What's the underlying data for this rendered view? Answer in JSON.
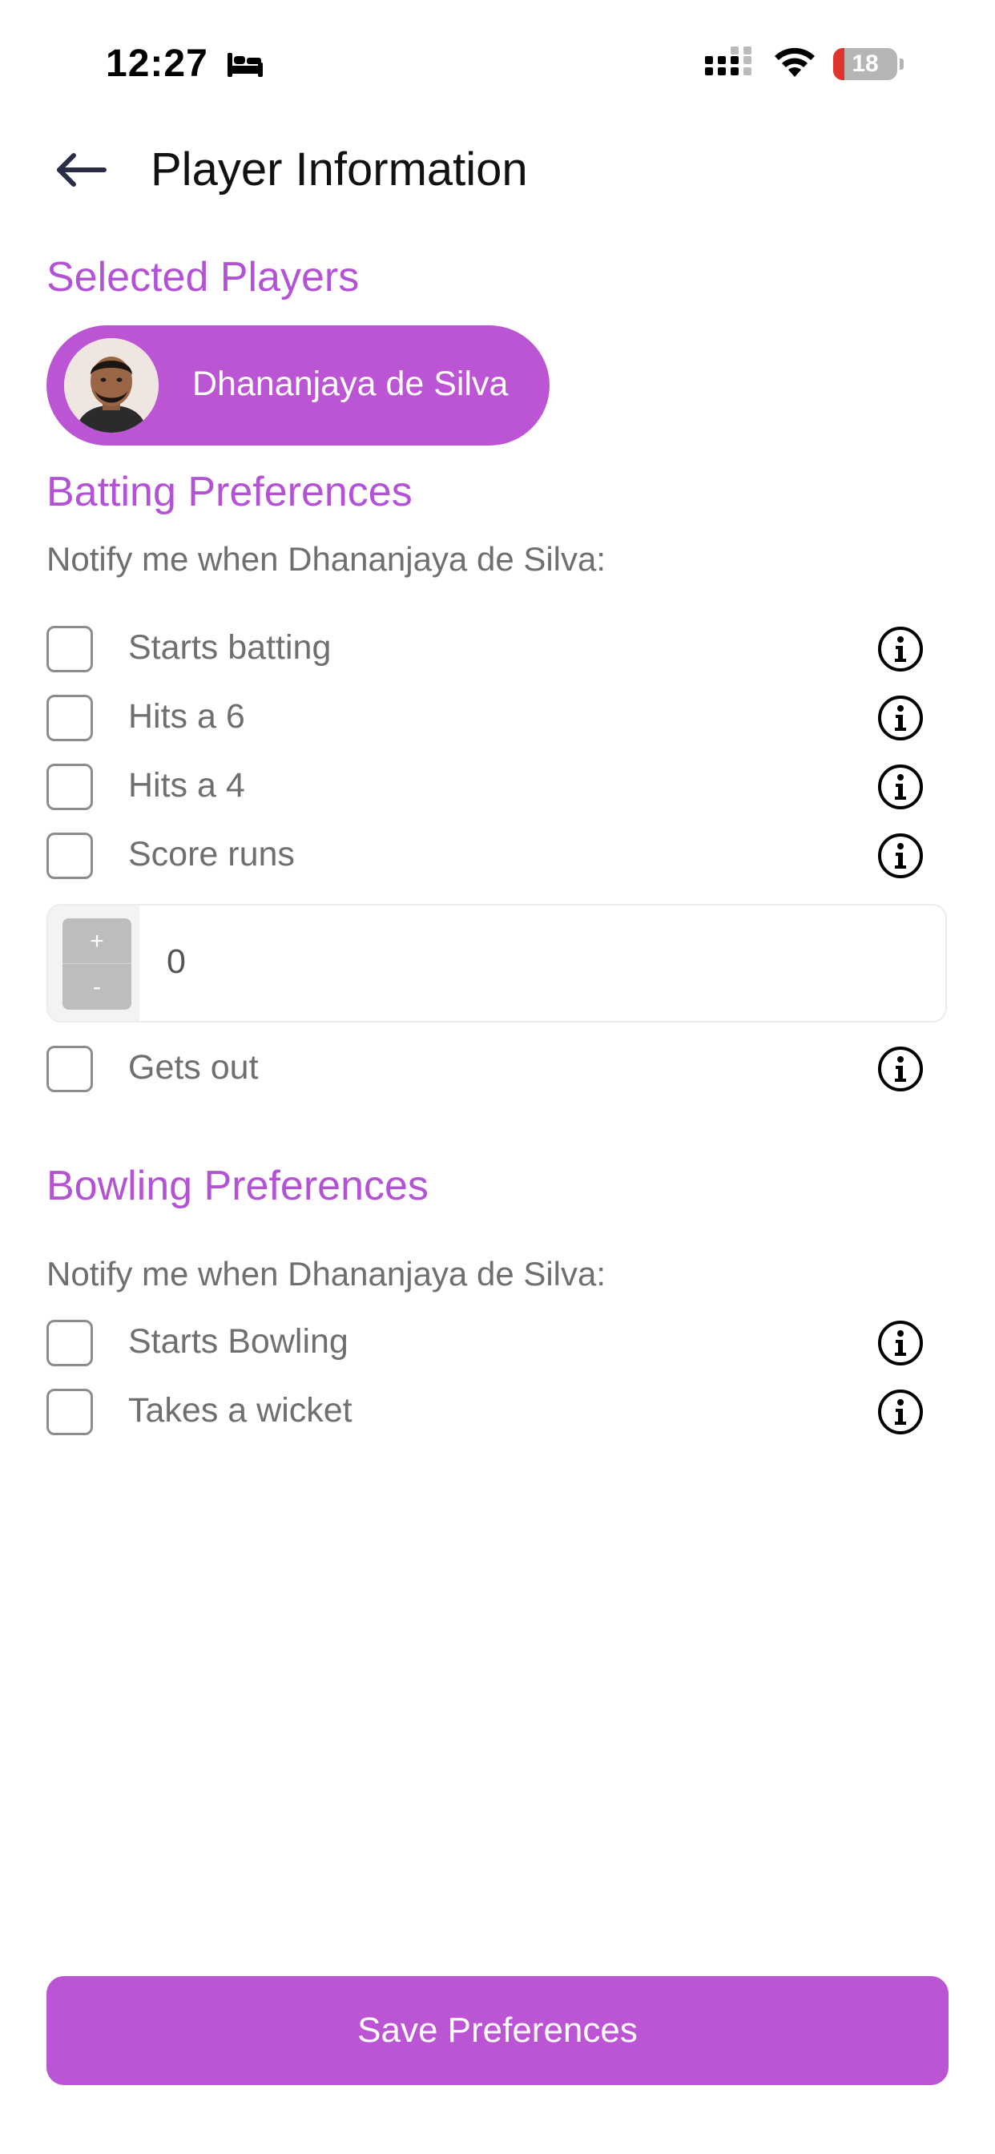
{
  "status_bar": {
    "time": "12:27",
    "battery_level": "18",
    "battery_fraction": 0.18
  },
  "header": {
    "title": "Player Information"
  },
  "selected_players": {
    "title": "Selected Players",
    "players": [
      {
        "name": "Dhananjaya de Silva"
      }
    ]
  },
  "batting": {
    "title": "Batting Preferences",
    "notify_text": "Notify me when Dhananjaya de Silva:",
    "options": [
      {
        "label": "Starts batting",
        "checked": false
      },
      {
        "label": "Hits a 6",
        "checked": false
      },
      {
        "label": "Hits a 4",
        "checked": false
      },
      {
        "label": "Score runs",
        "checked": false
      }
    ],
    "runs_stepper": {
      "plus_label": "+",
      "minus_label": "-",
      "value": "0"
    },
    "gets_out": {
      "label": "Gets out",
      "checked": false
    }
  },
  "bowling": {
    "title": "Bowling Preferences",
    "notify_text": "Notify me when Dhananjaya de Silva:",
    "options": [
      {
        "label": "Starts Bowling",
        "checked": false
      },
      {
        "label": "Takes a wicket",
        "checked": false
      }
    ]
  },
  "footer": {
    "save_label": "Save Preferences"
  },
  "colors": {
    "accent": "#bb55d4",
    "section_title": "#b452d6",
    "muted_text": "#6f6f6f"
  }
}
